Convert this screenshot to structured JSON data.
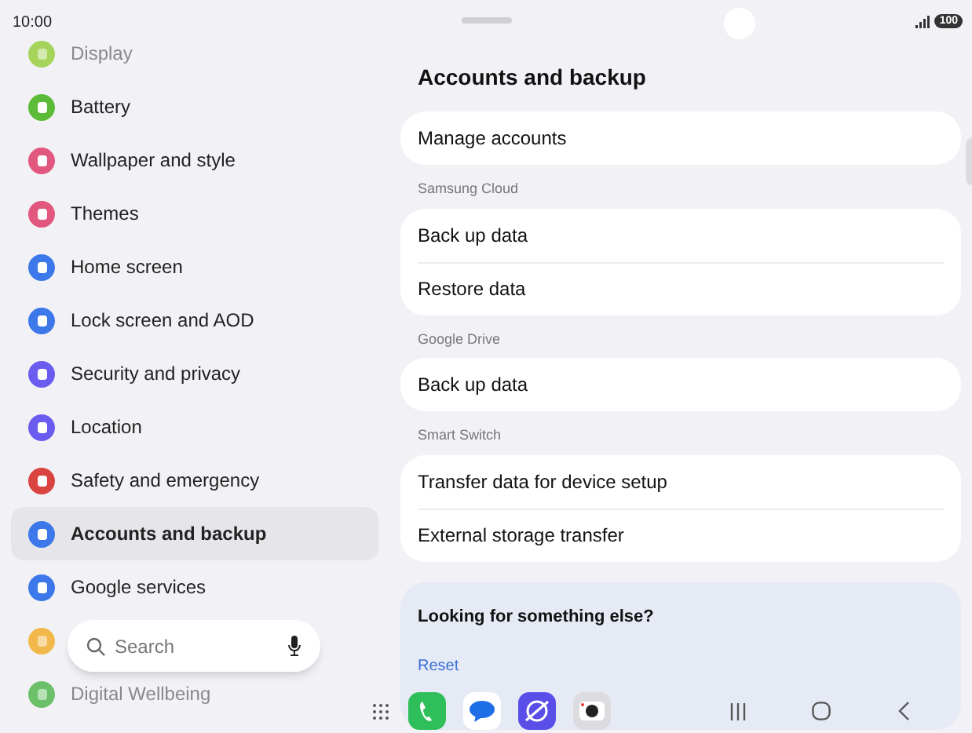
{
  "status_bar": {
    "time": "10:00",
    "battery": "100"
  },
  "sidebar": {
    "items": [
      {
        "label": "Display",
        "color": "#a6d35a",
        "dimmed": true,
        "selected": false
      },
      {
        "label": "Battery",
        "color": "#5dbb3a",
        "dimmed": false,
        "selected": false
      },
      {
        "label": "Wallpaper and style",
        "color": "#e2577d",
        "dimmed": false,
        "selected": false
      },
      {
        "label": "Themes",
        "color": "#e2577d",
        "dimmed": false,
        "selected": false
      },
      {
        "label": "Home screen",
        "color": "#3c78ea",
        "dimmed": false,
        "selected": false
      },
      {
        "label": "Lock screen and AOD",
        "color": "#3c78ea",
        "dimmed": false,
        "selected": false
      },
      {
        "label": "Security and privacy",
        "color": "#6b5cf0",
        "dimmed": false,
        "selected": false
      },
      {
        "label": "Location",
        "color": "#6b5cf0",
        "dimmed": false,
        "selected": false
      },
      {
        "label": "Safety and emergency",
        "color": "#d94440",
        "dimmed": false,
        "selected": false
      },
      {
        "label": "Accounts and backup",
        "color": "#3c78ea",
        "dimmed": false,
        "selected": true
      },
      {
        "label": "Google services",
        "color": "#3c78ea",
        "dimmed": false,
        "selected": false
      },
      {
        "color": "#f2b84b",
        "dimmed": true,
        "selected": false
      },
      {
        "label": "Digital Wellbeing",
        "color": "#6cc06a",
        "dimmed": true,
        "selected": false
      }
    ]
  },
  "search": {
    "placeholder": "Search"
  },
  "page": {
    "title": "Accounts and backup",
    "groups": [
      {
        "rows": [
          "Manage accounts"
        ]
      },
      {
        "header": "Samsung Cloud",
        "rows": [
          "Back up data",
          "Restore data"
        ]
      },
      {
        "header": "Google Drive",
        "rows": [
          "Back up data"
        ]
      },
      {
        "header": "Smart Switch",
        "rows": [
          "Transfer data for device setup",
          "External storage transfer"
        ]
      }
    ],
    "suggestion": {
      "title": "Looking for something else?",
      "link": "Reset"
    }
  },
  "dock": {
    "apps": [
      {
        "kind": "phone"
      },
      {
        "kind": "messages"
      },
      {
        "kind": "internet"
      },
      {
        "kind": "camera"
      }
    ]
  }
}
